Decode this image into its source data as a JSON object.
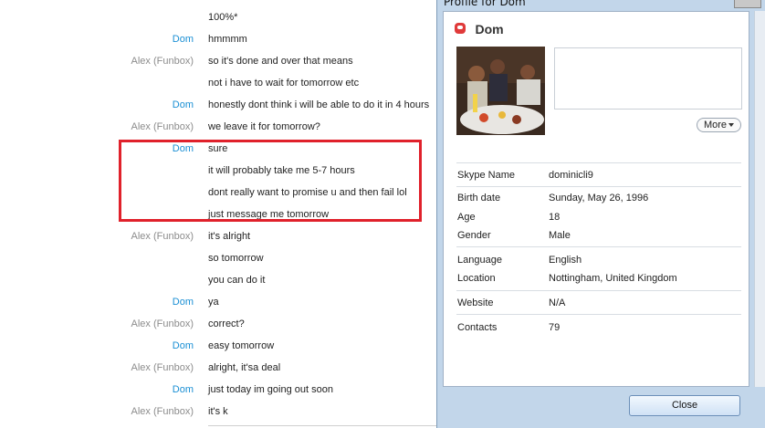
{
  "chat": {
    "messages": [
      {
        "sender": "",
        "text": "100%*",
        "type": "none"
      },
      {
        "sender": "Dom",
        "text": "hmmmm",
        "type": "dom"
      },
      {
        "sender": "Alex (Funbox)",
        "text": "so it's done and over that means",
        "type": "alex"
      },
      {
        "sender": "",
        "text": "not i have to wait for tomorrow etc",
        "type": "none"
      },
      {
        "sender": "Dom",
        "text": "honestly dont think i will be able to do it in 4 hours",
        "type": "dom"
      },
      {
        "sender": "Alex (Funbox)",
        "text": "we leave it for tomorrow?",
        "type": "alex"
      },
      {
        "sender": "Dom",
        "text": "sure",
        "type": "dom"
      },
      {
        "sender": "",
        "text": "it will probably take me 5-7 hours",
        "type": "none"
      },
      {
        "sender": "",
        "text": "dont really want to promise u and then fail lol",
        "type": "none"
      },
      {
        "sender": "",
        "text": "just message me tomorrow",
        "type": "none"
      },
      {
        "sender": "Alex (Funbox)",
        "text": "it's alright",
        "type": "alex"
      },
      {
        "sender": "",
        "text": "so tomorrow",
        "type": "none"
      },
      {
        "sender": "",
        "text": "you can do it",
        "type": "none"
      },
      {
        "sender": "Dom",
        "text": "ya",
        "type": "dom"
      },
      {
        "sender": "Alex (Funbox)",
        "text": "correct?",
        "type": "alex"
      },
      {
        "sender": "Dom",
        "text": "easy tomorrow",
        "type": "dom"
      },
      {
        "sender": "Alex (Funbox)",
        "text": "alright, it'sa  deal",
        "type": "alex"
      },
      {
        "sender": "Dom",
        "text": "just today im going out soon",
        "type": "dom"
      },
      {
        "sender": "Alex (Funbox)",
        "text": "it's k",
        "type": "alex"
      }
    ]
  },
  "profile_window": {
    "title": "Profile for Dom",
    "name": "Dom",
    "more_label": "More",
    "close_label": "Close",
    "fields": {
      "skype_name": {
        "label": "Skype Name",
        "value": "dominicli9"
      },
      "birth_date": {
        "label": "Birth date",
        "value": "Sunday, May 26, 1996"
      },
      "age": {
        "label": "Age",
        "value": "18"
      },
      "gender": {
        "label": "Gender",
        "value": "Male"
      },
      "language": {
        "label": "Language",
        "value": "English"
      },
      "location": {
        "label": "Location",
        "value": "Nottingham, United Kingdom"
      },
      "website": {
        "label": "Website",
        "value": "N/A"
      },
      "contacts": {
        "label": "Contacts",
        "value": "79"
      }
    }
  },
  "colors": {
    "dom_sender": "#1a8fd4",
    "alex_sender": "#8c8c8c",
    "highlight_border": "#e0212b"
  }
}
